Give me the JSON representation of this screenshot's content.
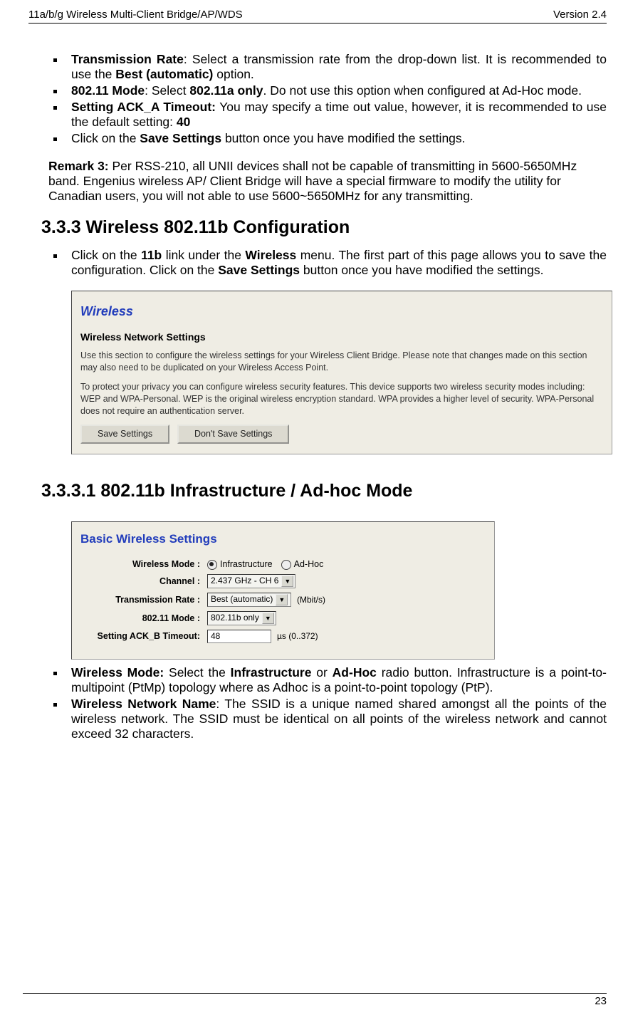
{
  "header": {
    "left": "11a/b/g Wireless Multi-Client Bridge/AP/WDS",
    "right": "Version 2.4"
  },
  "bullets_top": {
    "b1": {
      "label": "Transmission Rate",
      "text": ": Select a transmission rate from the drop-down list. It is recommended to use the ",
      "bold1": "Best (automatic)",
      "tail": " option."
    },
    "b2": {
      "label": "802.11 Mode",
      "text": ": Select ",
      "bold1": "802.11a only",
      "tail": ". Do not use this option when configured at Ad-Hoc mode."
    },
    "b3": {
      "label": "Setting ACK_A Timeout:",
      "text": " You may specify a time out value, however, it is recommended to use the default setting: ",
      "bold1": "40"
    },
    "b4": {
      "pre": "Click on the ",
      "bold1": "Save Settings",
      "tail": " button once you have modified the settings."
    }
  },
  "remark": {
    "label": "Remark 3:",
    "text": " Per RSS-210, all UNII devices shall not be capable of transmitting in 5600-5650MHz band. Engenius wireless AP/ Client Bridge will have a special firmware to modify the utility for Canadian users, you will not able to use 5600~5650MHz for any transmitting."
  },
  "h2": "3.3.3 Wireless 802.11b Configuration",
  "para_after_h2": {
    "pre": "Click on the ",
    "b1": "11b",
    "mid1": " link under the ",
    "b2": "Wireless",
    "mid2": " menu. The first part of this page allows you to save the configuration. Click on the ",
    "b3": "Save Settings",
    "tail": " button once you have modified the settings."
  },
  "fig1": {
    "title": "Wireless",
    "subhead": "Wireless Network Settings",
    "p1": "Use this section to configure the wireless settings for your Wireless Client Bridge. Please note that changes made on this section may also need to be duplicated on your Wireless Access Point.",
    "p2": "To protect your privacy you can configure wireless security features. This device supports two wireless security modes including: WEP and WPA-Personal. WEP is the original wireless encryption standard. WPA provides a higher level of security. WPA-Personal does not require an authentication server.",
    "btn1": "Save Settings",
    "btn2": "Don't Save Settings"
  },
  "h3": "3.3.3.1   802.11b Infrastructure / Ad-hoc Mode",
  "fig2": {
    "title": "Basic Wireless Settings",
    "row1": {
      "label": "Wireless Mode :",
      "opt1": "Infrastructure",
      "opt2": "Ad-Hoc"
    },
    "row2": {
      "label": "Channel :",
      "value": "2.437 GHz - CH 6"
    },
    "row3": {
      "label": "Transmission Rate :",
      "value": "Best (automatic)",
      "unit": "(Mbit/s)"
    },
    "row4": {
      "label": "802.11 Mode :",
      "value": "802.11b only"
    },
    "row5": {
      "label": "Setting ACK_B Timeout:",
      "value": "48",
      "unit": "µs (0..372)"
    }
  },
  "bullets_bottom": {
    "b1": {
      "label": "Wireless Mode:",
      "pre": " Select the ",
      "b1": "Infrastructure",
      "mid": " or ",
      "b2": "Ad-Hoc",
      "tail": " radio button. Infrastructure is a point-to-multipoint (PtMp) topology where as Adhoc is a point-to-point topology (PtP)."
    },
    "b2": {
      "label": "Wireless Network Name",
      "text": ": The SSID is a unique named shared amongst all the points of the wireless network. The SSID must be identical on all points of the wireless network and cannot exceed 32 characters."
    }
  },
  "page_number": "23"
}
